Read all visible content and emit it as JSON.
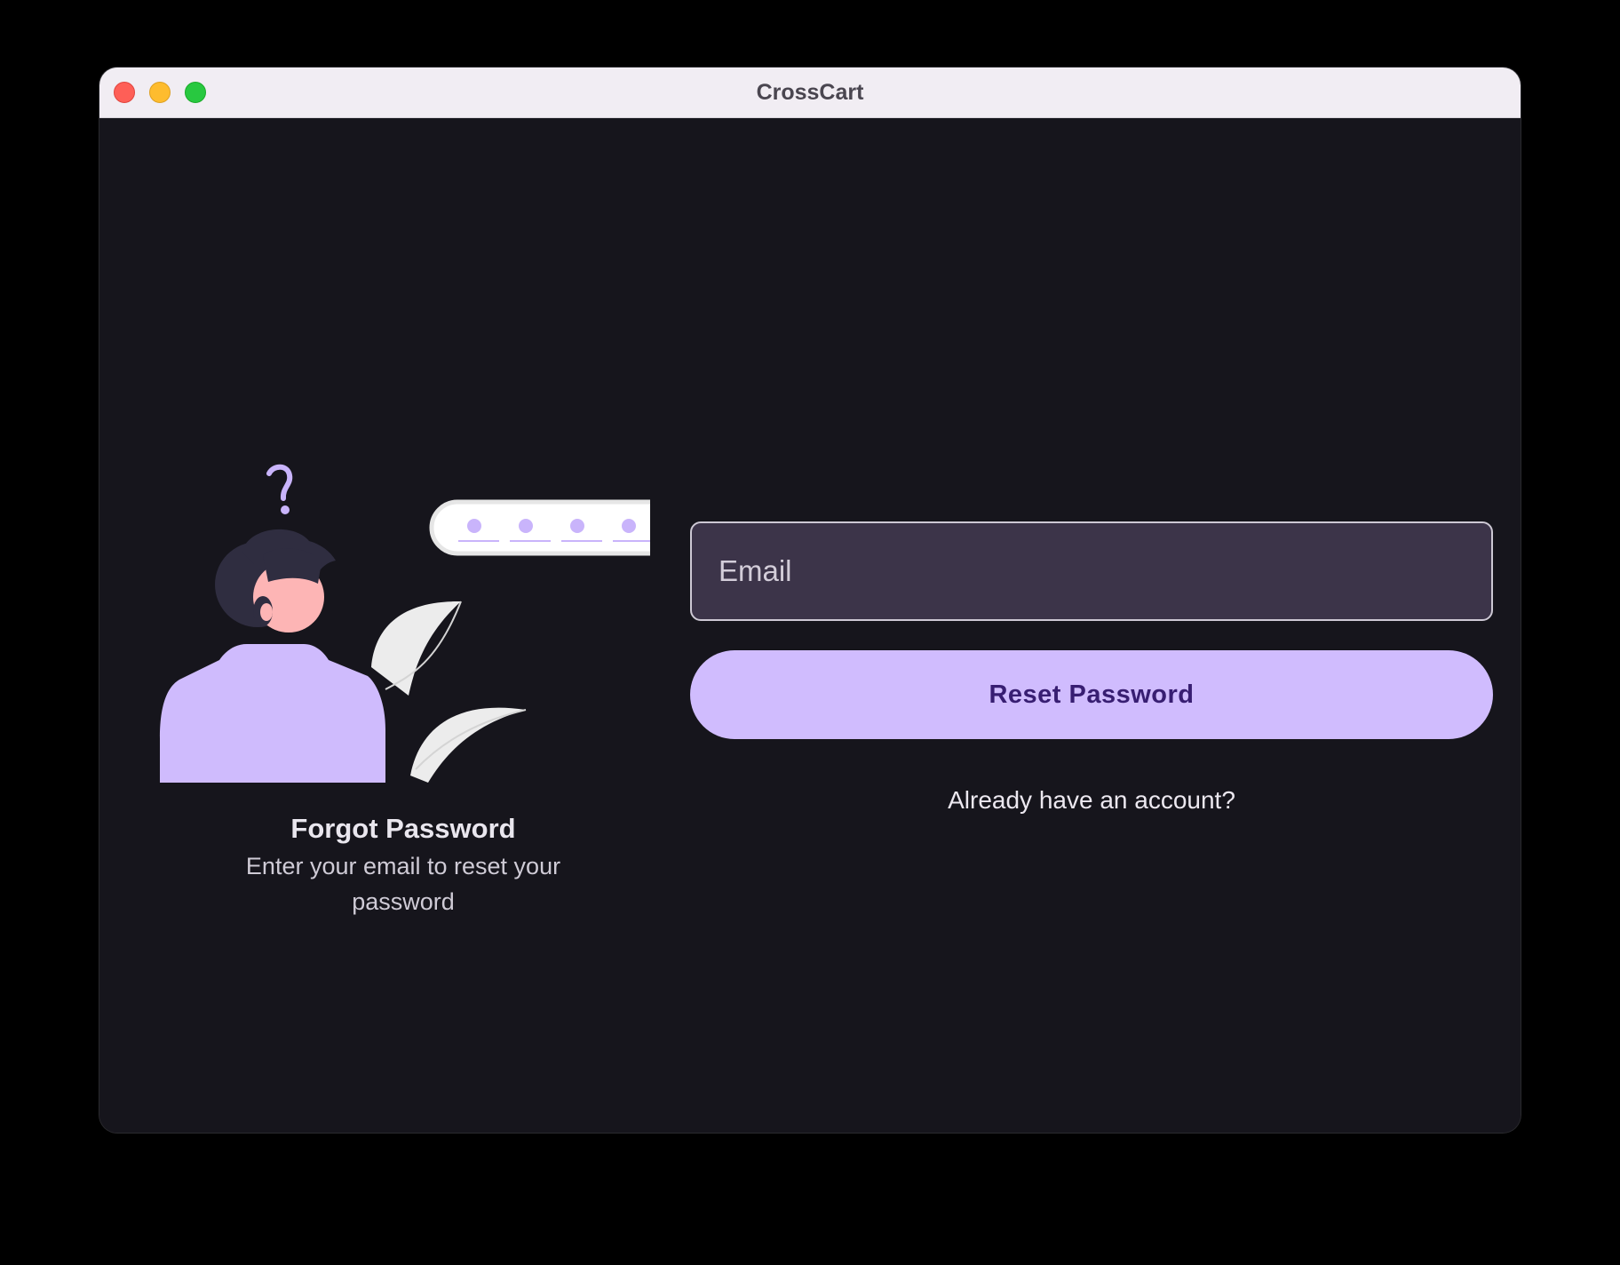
{
  "window": {
    "title": "CrossCart"
  },
  "left_panel": {
    "heading": "Forgot Password",
    "subtitle": "Enter your email to reset your password",
    "illustration": "person-forgot-password-illustration"
  },
  "form": {
    "email_placeholder": "Email",
    "email_value": "",
    "reset_button_label": "Reset Password",
    "login_link_label": "Already have an account?"
  },
  "colors": {
    "accent": "#d0bcfe",
    "accent_text": "#381e72",
    "background": "#16151c",
    "input_fill": "#3c3449"
  }
}
